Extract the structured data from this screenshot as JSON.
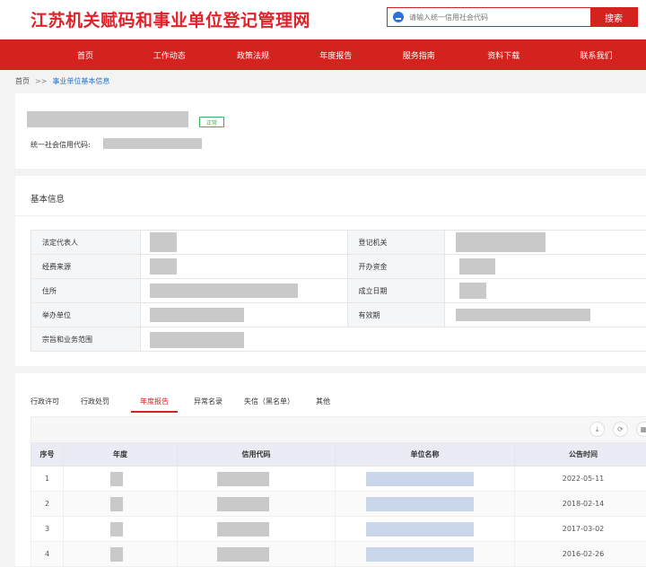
{
  "header": {
    "site_title": "江苏机关赋码和事业单位登记管理网",
    "search_placeholder": "请输入统一信用社会代码",
    "search_button": "搜索"
  },
  "nav": {
    "items": [
      {
        "label": "首页"
      },
      {
        "label": "工作动态"
      },
      {
        "label": "政策法规"
      },
      {
        "label": "年度报告"
      },
      {
        "label": "服务指南"
      },
      {
        "label": "资料下载"
      },
      {
        "label": "联系我们"
      }
    ]
  },
  "breadcrumb": {
    "home": "首页",
    "separator": ">>",
    "current": "事业单位基本信息"
  },
  "org": {
    "status": "正常",
    "uscc_label": "统一社会信用代码:"
  },
  "basic_info": {
    "title": "基本信息",
    "fields": {
      "legal_rep": "法定代表人",
      "reg_authority": "登记机关",
      "funding_source": "经费来源",
      "capital": "开办资金",
      "address": "住所",
      "established": "成立日期",
      "sponsor": "举办单位",
      "validity": "有效期",
      "scope": "宗旨和业务范围"
    }
  },
  "records": {
    "tabs": [
      {
        "label": "行政许可"
      },
      {
        "label": "行政处罚"
      },
      {
        "label": "年度报告"
      },
      {
        "label": "异常名录"
      },
      {
        "label": "失信（黑名单）"
      },
      {
        "label": "其他"
      }
    ],
    "active_tab": "年度报告",
    "columns": [
      "序号",
      "年度",
      "信用代码",
      "单位名称",
      "公告时间"
    ],
    "rows": [
      {
        "no": "1",
        "date": "2022-05-11"
      },
      {
        "no": "2",
        "date": "2018-02-14"
      },
      {
        "no": "3",
        "date": "2017-03-02"
      },
      {
        "no": "4",
        "date": "2016-02-26"
      }
    ]
  },
  "colors": {
    "brand_red": "#d4231f",
    "status_green": "#35b35a",
    "link_blue": "#2a72c8"
  }
}
